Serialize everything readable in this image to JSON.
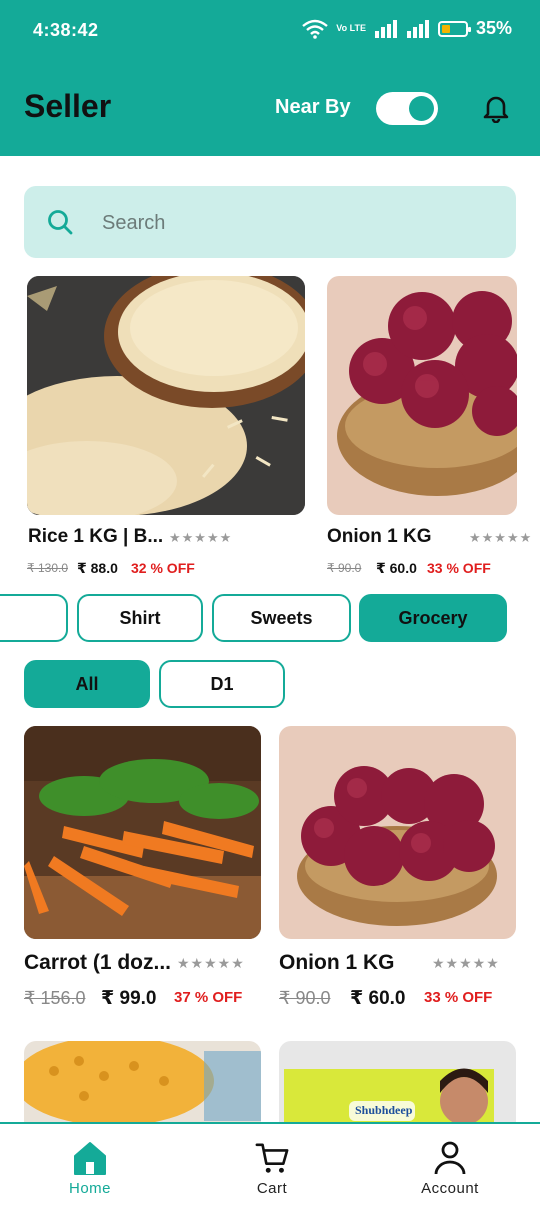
{
  "status_bar": {
    "time": "4:38:42",
    "network": "Vo LTE",
    "battery": "35%",
    "battery_level": 0.35
  },
  "header": {
    "title": "Seller",
    "nearby_label": "Near By",
    "nearby_enabled": true,
    "bell_icon": "bell-icon"
  },
  "search": {
    "placeholder": "Search",
    "icon": "search-icon"
  },
  "featured": [
    {
      "name": "Rice 1 KG | B...",
      "stars": "★★★★★",
      "old_price": "₹ 130.0",
      "price": "₹ 88.0",
      "discount": "32 % OFF"
    },
    {
      "name": "Onion 1 KG",
      "stars": "★★★★★",
      "old_price": "₹ 90.0",
      "price": "₹ 60.0",
      "discount": "33 % OFF"
    }
  ],
  "categories": [
    {
      "label": "",
      "active": false
    },
    {
      "label": "Shirt",
      "active": false
    },
    {
      "label": "Sweets",
      "active": false
    },
    {
      "label": "Grocery",
      "active": true
    }
  ],
  "subcategories": [
    {
      "label": "All",
      "active": true
    },
    {
      "label": "D1",
      "active": false
    }
  ],
  "products": [
    {
      "name": "Carrot (1 doz...",
      "stars": "★★★★★",
      "old_price": "₹ 156.0",
      "price": "₹ 99.0",
      "discount": "37 % OFF"
    },
    {
      "name": "Onion 1 KG",
      "stars": "★★★★★",
      "old_price": "₹ 90.0",
      "price": "₹ 60.0",
      "discount": "33 % OFF"
    },
    {
      "name": "",
      "stars": "",
      "old_price": "",
      "price": "",
      "discount": ""
    },
    {
      "name": "",
      "brand_text": "Shubhdeep",
      "stars": "",
      "old_price": "",
      "price": "",
      "discount": ""
    }
  ],
  "bottom_nav": {
    "items": [
      {
        "label": "Home",
        "icon": "home-icon",
        "active": true
      },
      {
        "label": "Cart",
        "icon": "cart-icon",
        "active": false
      },
      {
        "label": "Account",
        "icon": "account-icon",
        "active": false
      }
    ]
  },
  "colors": {
    "primary": "#14aa98",
    "search_bg": "#cdeeea",
    "discount": "#e01e1e",
    "stars": "#9a9a9a"
  }
}
